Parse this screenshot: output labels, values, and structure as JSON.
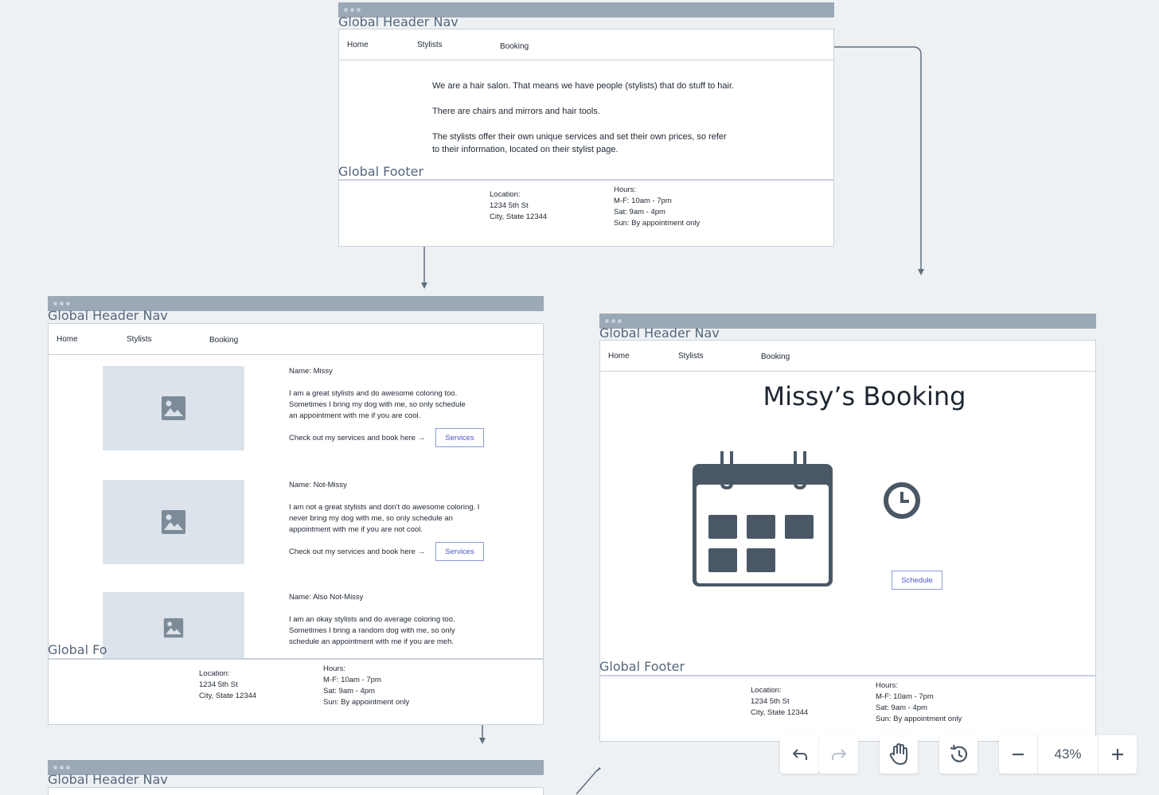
{
  "nav": {
    "home": "Home",
    "stylists": "Stylists",
    "booking": "Booking"
  },
  "labels": {
    "header": "Global Header Nav",
    "footer": "Global Footer",
    "footer_cut": "Global Fo"
  },
  "home": {
    "p1": "We are a hair salon. That means we have people (stylists) that do stuff to hair.",
    "p2": "There are chairs and mirrors and hair tools.",
    "p3a": "The stylists offer their own unique services and set their own prices, so refer",
    "p3b": "to their information, located on their stylist page."
  },
  "footer": {
    "location": "Location:\n1234 5th St\nCity, State 12344",
    "hours": "Hours:\nM-F: 10am - 7pm\nSat: 9am - 4pm\nSun: By appointment only"
  },
  "stylists": [
    {
      "name": "Name: Missy",
      "bio": "I am a great stylists and do awesome coloring too. Sometimes I bring my dog with me, so only schedule an appointment with me if you are cool.",
      "cta": "Check out my services and book here →",
      "button": "Services"
    },
    {
      "name": "Name: Not-Missy",
      "bio": "I am not a great stylists and don't do awesome coloring. I never bring my dog with me, so only schedule an appointment with me if you are not cool.",
      "cta": "Check out my services and book here →",
      "button": "Services"
    },
    {
      "name": "Name: Also Not-Missy",
      "bio": "I am an okay stylists and do average coloring too. Sometimes I bring a random dog with me, so only schedule an appointment with me if you are meh."
    }
  ],
  "booking": {
    "title": "Missy’s Booking",
    "schedule": "Schedule"
  },
  "toolbar": {
    "zoom": "43%"
  },
  "icons": [
    "undo-icon",
    "redo-icon",
    "hand-icon",
    "history-icon",
    "zoom-out-icon",
    "zoom-in-icon",
    "image-placeholder-icon",
    "calendar-icon",
    "clock-icon"
  ],
  "colors": {
    "frame_bar": "#9ba8b6",
    "icon": "#4a5866",
    "button_text": "#4b55c8",
    "connector": "#5f6e7d"
  }
}
